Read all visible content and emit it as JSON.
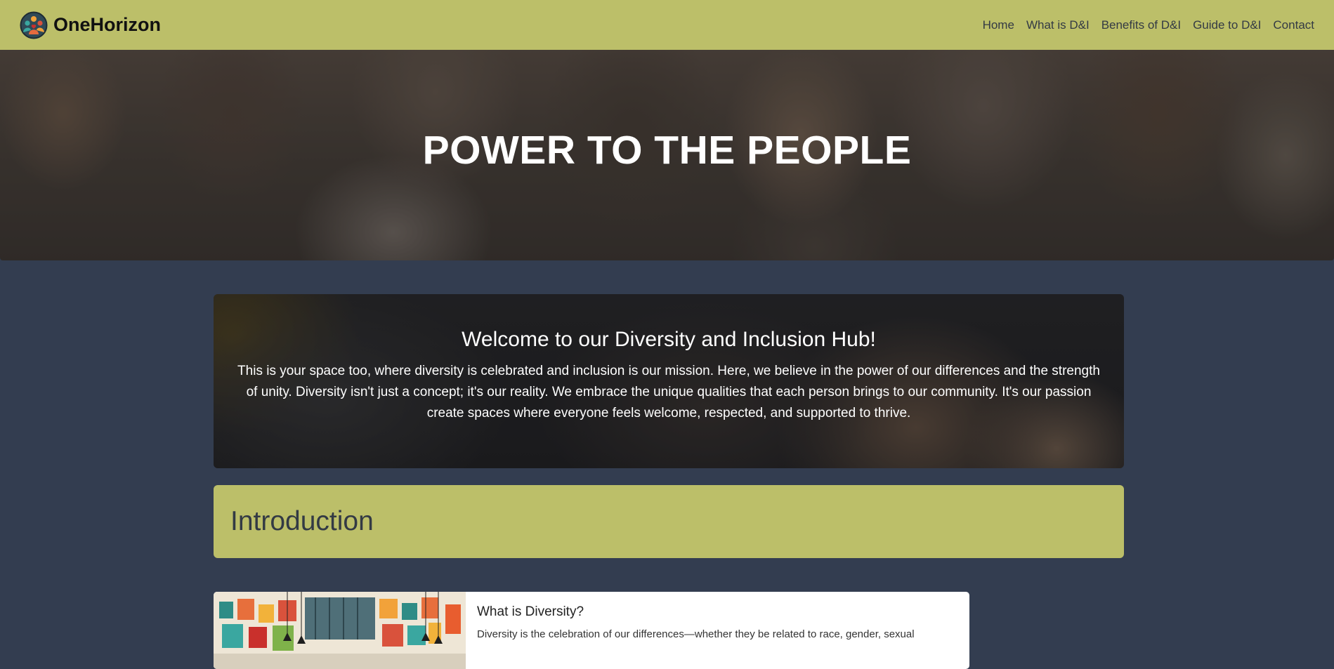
{
  "navbar": {
    "brand": "OneHorizon",
    "links": [
      "Home",
      "What is D&I",
      "Benefits of D&I",
      "Guide to D&I",
      "Contact"
    ]
  },
  "hero": {
    "title": "POWER TO THE PEOPLE"
  },
  "welcome": {
    "title": "Welcome to our Diversity and Inclusion Hub!",
    "text": "This is your space too, where diversity is celebrated and inclusion is our mission. Here, we believe in the power of our differences and the strength of unity. Diversity isn't just a concept; it's our reality. We embrace the unique qualities that each person brings to our community. It's our passion create spaces where everyone feels welcome, respected, and supported to thrive."
  },
  "introduction": {
    "title": "Introduction"
  },
  "diversity_card": {
    "title": "What is Diversity?",
    "text": "Diversity is the celebration of our differences—whether they be related to race, gender, sexual"
  },
  "colors": {
    "navbar_bg": "#bcbf69",
    "page_bg": "#333d50",
    "banner_bg": "#bcbf69",
    "card_bg": "#ffffff"
  },
  "icons": {
    "logo": "people-circle-logo-icon"
  }
}
